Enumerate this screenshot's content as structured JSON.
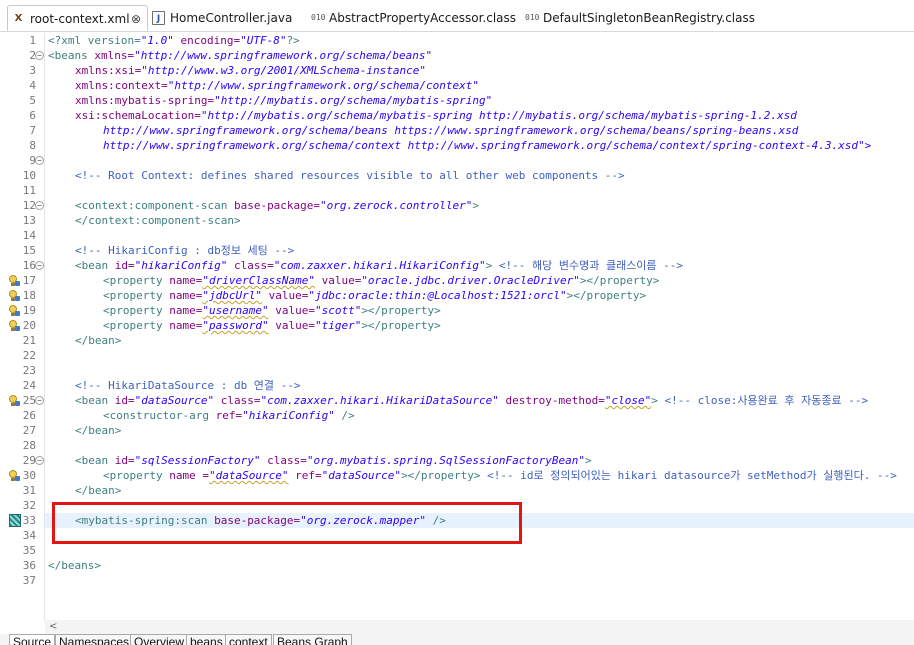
{
  "tabs": [
    {
      "label": "root-context.xml",
      "icon": "xml-file-icon",
      "active": true,
      "close": "⊗"
    },
    {
      "label": "HomeController.java",
      "icon": "java-file-icon"
    },
    {
      "label": "AbstractPropertyAccessor.class",
      "icon": "class-file-icon"
    },
    {
      "label": "DefaultSingletonBeanRegistry.class",
      "icon": "class-file-icon"
    }
  ],
  "icons": {
    "xml": "X",
    "java": "J",
    "class": "010"
  },
  "fold_symbol": "−",
  "scroll_left_arrow": "<",
  "line_numbers": [
    "1",
    "2",
    "3",
    "4",
    "5",
    "6",
    "7",
    "8",
    "9",
    "10",
    "11",
    "12",
    "13",
    "14",
    "15",
    "16",
    "17",
    "18",
    "19",
    "20",
    "21",
    "22",
    "23",
    "24",
    "25",
    "26",
    "27",
    "28",
    "29",
    "30",
    "31",
    "32",
    "33",
    "34",
    "35",
    "36",
    "37"
  ],
  "code": {
    "l1": [
      "<?xml version=",
      "\"1.0\"",
      " encoding=",
      "\"UTF-8\"",
      "?>"
    ],
    "l2": [
      "<beans",
      " xmlns=",
      "\"http://www.springframework.org/schema/beans\""
    ],
    "l3": [
      "xmlns:xsi=",
      "\"http://www.w3.org/2001/XMLSchema-instance\""
    ],
    "l4": [
      "xmlns:context=",
      "\"http://www.springframework.org/schema/context\""
    ],
    "l5": [
      "xmlns:mybatis-spring=",
      "\"http://mybatis.org/schema/mybatis-spring\""
    ],
    "l6": [
      "xsi:schemaLocation=",
      "\"http://mybatis.org/schema/mybatis-spring http://mybatis.org/schema/mybatis-spring-1.2.xsd"
    ],
    "l7": "http://www.springframework.org/schema/beans https://www.springframework.org/schema/beans/spring-beans.xsd",
    "l8": "http://www.springframework.org/schema/context http://www.springframework.org/schema/context/spring-context-4.3.xsd\">",
    "l10": "<!-- Root Context: defines shared resources visible to all other web components -->",
    "l12": [
      "<context:component-scan",
      " base-package=",
      "\"org.zerock.controller\"",
      ">"
    ],
    "l13": "</context:component-scan>",
    "l15": "<!-- HikariConfig : db정보 세팅 -->",
    "l16": [
      "<bean",
      " id=",
      "\"hikariConfig\"",
      " class=",
      "\"com.zaxxer.hikari.HikariConfig\"",
      ">",
      " <!-- 해당 변수명과 클래스이름 -->"
    ],
    "l17": [
      "<property",
      " name=",
      "\"driverClassName\"",
      " value=",
      "\"oracle.jdbc.driver.OracleDriver\"",
      "></property>"
    ],
    "l18": [
      "<property",
      " name=",
      "\"jdbcUrl\"",
      " value=",
      "\"jdbc:oracle:thin:@Localhost:1521:orcl\"",
      "></property>"
    ],
    "l19": [
      "<property",
      " name=",
      "\"username\"",
      " value=",
      "\"scott\"",
      "></property>"
    ],
    "l20": [
      "<property",
      " name=",
      "\"password\"",
      " value=",
      "\"tiger\"",
      "></property>"
    ],
    "l21": "</bean>",
    "l24": "<!-- HikariDataSource : db 연결 -->",
    "l25": [
      "<bean",
      " id=",
      "\"dataSource\"",
      " class=",
      "\"com.zaxxer.hikari.HikariDataSource\"",
      " destroy-method=",
      "\"close\"",
      ">",
      " <!-- close:사용완료 후 자동종료 -->"
    ],
    "l26": [
      "<constructor-arg",
      " ref=",
      "\"hikariConfig\"",
      " />"
    ],
    "l27": "</bean>",
    "l29": [
      "<bean",
      " id=",
      "\"sqlSessionFactory\"",
      " class=",
      "\"org.mybatis.spring.SqlSessionFactoryBean\"",
      ">"
    ],
    "l30": [
      "<property",
      " name =",
      "\"dataSource\"",
      " ref=",
      "\"dataSource\"",
      "></property>",
      " <!-- id로 정의되어있는 hikari datasource가 setMethod가 실행된다. -->"
    ],
    "l31": "</bean>",
    "l33": [
      "<mybatis-spring:scan",
      " base-package=",
      "\"org.zerock.mapper\"",
      " />"
    ],
    "l36": "</beans>"
  },
  "bottom_tabs": [
    "Source",
    "Namespaces",
    "Overview",
    "beans",
    "context",
    "Beans Graph"
  ],
  "colors": {
    "tag": "#3f7f7f",
    "attr": "#7f007f",
    "value": "#2a00ff",
    "comment": "#3f5fbf",
    "highlight_box": "#e21515",
    "current_line": "#e8f2fe"
  }
}
